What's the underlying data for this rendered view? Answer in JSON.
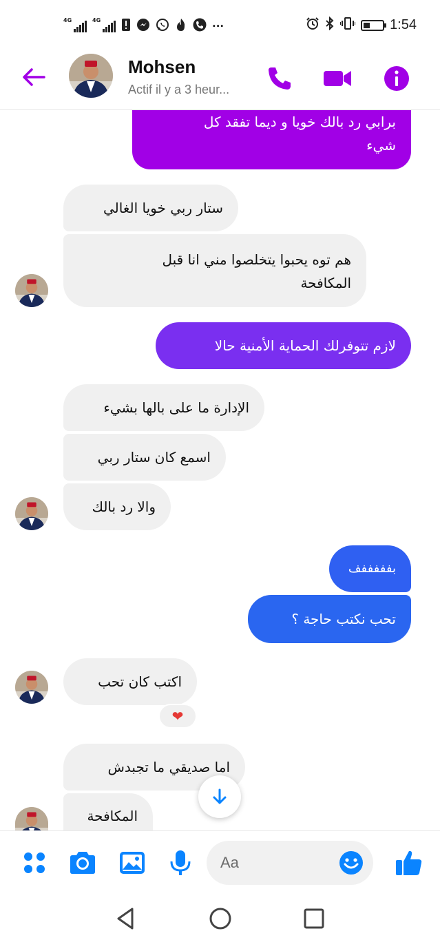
{
  "status_bar": {
    "network_1": "4G",
    "network_2": "4G",
    "time": "1:54",
    "icons": [
      "alert-icon",
      "messenger-icon",
      "whatsapp-icon",
      "fire-icon",
      "phone-call-icon",
      "more-dots-icon",
      "alarm-icon",
      "bluetooth-icon",
      "vibrate-icon",
      "battery-icon"
    ],
    "more_text": "···"
  },
  "header": {
    "name": "Mohsen",
    "status": "Actif il y a 3 heur...",
    "accent_color": "#a100e6"
  },
  "messages": [
    {
      "side": "out",
      "lines": [
        "برابي رد بالك خويا و ديما تفقد كل",
        "شيء"
      ]
    },
    {
      "side": "in",
      "lines": [
        "ستار ربي خويا الغالي"
      ]
    },
    {
      "side": "in",
      "lines": [
        "هم توه يحبوا يتخلصوا مني انا قبل",
        "المكافحة"
      ]
    },
    {
      "side": "out",
      "lines": [
        "لازم تتوفرلك الحماية الأمنية حالا"
      ]
    },
    {
      "side": "in",
      "lines": [
        "الإدارة ما على بالها بشيء"
      ]
    },
    {
      "side": "in",
      "lines": [
        "اسمع كان ستار ربي"
      ]
    },
    {
      "side": "in",
      "lines": [
        "والا رد بالك"
      ]
    },
    {
      "side": "out",
      "lines": [
        "بفففففف"
      ]
    },
    {
      "side": "out",
      "lines": [
        "تحب نكتب حاجة ؟"
      ]
    },
    {
      "side": "in",
      "lines": [
        "اكتب كان تحب"
      ]
    },
    {
      "side": "in",
      "lines": [
        "اما صديقي ما تجبدش"
      ]
    },
    {
      "side": "in",
      "lines": [
        "المكافحة"
      ]
    }
  ],
  "reaction": "❤",
  "composer": {
    "placeholder": "Aa"
  },
  "colors": {
    "bubble_purple": "#a100e6",
    "bubble_violet": "#7a2ff0",
    "bubble_blue": "#2a66f0",
    "bubble_in": "#f0f0f0",
    "icon_blue": "#0a84ff"
  }
}
